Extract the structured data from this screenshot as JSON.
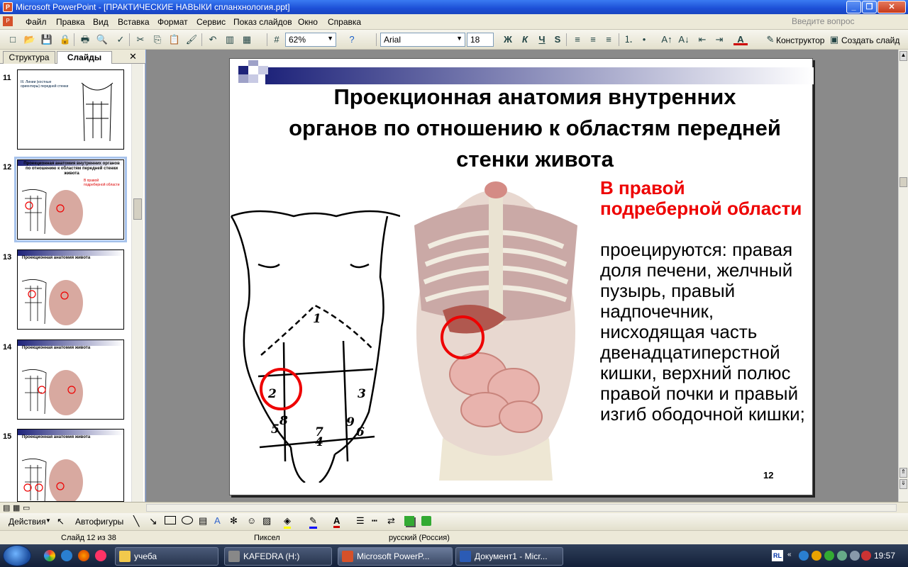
{
  "window": {
    "title": "Microsoft PowerPoint - [ПРАКТИЧЕСКИЕ НАВЫКИ спланхнология.ppt]"
  },
  "menu": {
    "items": [
      "Файл",
      "Правка",
      "Вид",
      "Вставка",
      "Формат",
      "Сервис",
      "Показ слайдов",
      "Окно",
      "Справка"
    ],
    "help_hint": "Введите вопрос"
  },
  "toolbar": {
    "zoom": "62%",
    "font": "Arial",
    "font_size": "18",
    "bold": "Ж",
    "italic": "К",
    "underline": "Ч",
    "shadow": "S",
    "designer": "Конструктор",
    "new_slide": "Создать слайд"
  },
  "left_pane": {
    "tabs": [
      "Структура",
      "Слайды"
    ],
    "slides": [
      {
        "num": "11",
        "title": "III. Линии (костные ориентиры) передней стенки"
      },
      {
        "num": "12",
        "title": "Проекционная анатомия внутренних органов по отношению к областям передней стенки живота"
      },
      {
        "num": "13",
        "title": "Проекционная анатомия живота"
      },
      {
        "num": "14",
        "title": "Проекционная анатомия живота"
      },
      {
        "num": "15",
        "title": "Проекционная анатомия живота"
      }
    ]
  },
  "slide": {
    "title": "Проекционная анатомия внутренних органов по отношению к областям передней стенки живота",
    "highlight": "В правой подреберной области",
    "body": "проецируются: правая доля печени, желчный пузырь, правый надпочечник, нисходящая часть двенадцатиперстной кишки, верхний полюс правой почки и правый изгиб ободочной кишки;",
    "number": "12",
    "region_numbers": [
      "1",
      "2",
      "3",
      "4",
      "5",
      "6",
      "7",
      "8",
      "9"
    ]
  },
  "draw_toolbar": {
    "actions": "Действия",
    "autoshapes": "Автофигуры"
  },
  "status": {
    "slide": "Слайд 12 из 38",
    "design": "Пиксел",
    "language": "русский (Россия)"
  },
  "taskbar": {
    "tasks": [
      "учеба",
      "KAFEDRA (H:)",
      "Microsoft PowerP...",
      "Документ1 - Micr..."
    ],
    "lang": "RL",
    "clock": "19:57"
  },
  "colors": {
    "accent_red": "#e00000",
    "title_bar": "#1c4fd6",
    "slide_header": "#1e237a"
  }
}
